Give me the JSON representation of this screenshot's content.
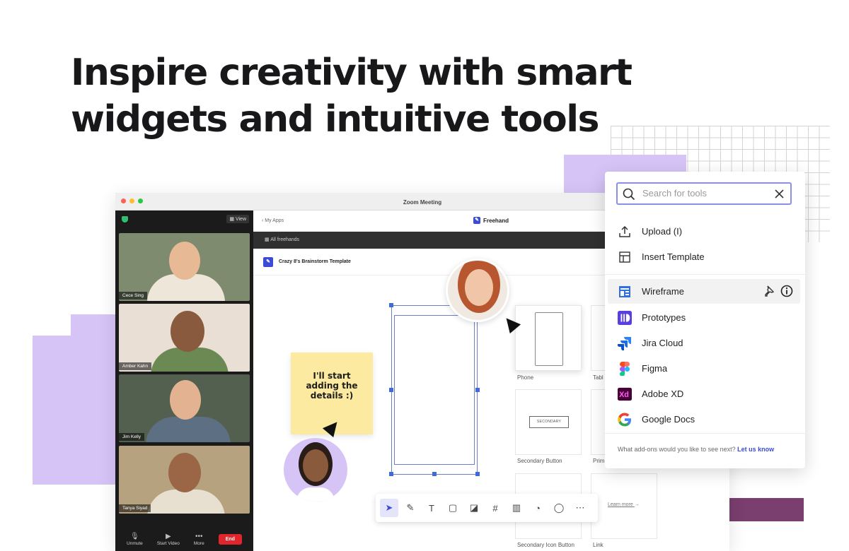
{
  "headline": {
    "line1": "Inspire creativity with smart",
    "line2": "widgets and intuitive tools"
  },
  "zoom": {
    "title": "Zoom Meeting",
    "view_label": "View",
    "participants": [
      {
        "name": "Cece Sing",
        "bg": "#7f8b6f",
        "skin": "#e8b995",
        "shirt": "#efe6da"
      },
      {
        "name": "Amber Kahn",
        "bg": "#eadfd4",
        "skin": "#8a5a3f",
        "shirt": "#6b8a53"
      },
      {
        "name": "Jim Kelly",
        "bg": "#54604f",
        "skin": "#e2b291",
        "shirt": "#5c6f83"
      },
      {
        "name": "Tanya Siyad",
        "bg": "#b6a27e",
        "skin": "#9a6645",
        "shirt": "#e7e0d1"
      }
    ],
    "controls": {
      "unmute": "Unmute",
      "start_video": "Start Video",
      "more": "More",
      "end": "End"
    }
  },
  "freehand": {
    "back": "My Apps",
    "app_name": "Freehand",
    "all_freehands": "All freehands",
    "template_name": "Crazy 8's Brainstorm Template",
    "sticky_text": "I'll start adding the details :)",
    "cards": {
      "phone": "Phone",
      "tablet": "Tabl",
      "secondary_button": "Secondary Button",
      "secondary_button_inner": "SECONDARY",
      "primary": "Prim",
      "secondary_icon_button": "Secondary Icon Button",
      "link": "Link"
    },
    "learn_more": "Learn more"
  },
  "tools_popup": {
    "search_placeholder": "Search for tools",
    "items": [
      {
        "label": "Upload (I)"
      },
      {
        "label": "Insert Template"
      },
      {
        "label": "Wireframe"
      },
      {
        "label": "Prototypes"
      },
      {
        "label": "Jira Cloud"
      },
      {
        "label": "Figma"
      },
      {
        "label": "Adobe XD"
      },
      {
        "label": "Google Docs"
      }
    ],
    "footer_question": "What add-ons would you like to see next?",
    "footer_link": "Let us know"
  },
  "colors": {
    "accent": "#3b4bd8",
    "lavender": "#d7c4f7",
    "plum": "#7a3e6f",
    "sticky": "#fbea9f",
    "end_button": "#e0262c"
  }
}
